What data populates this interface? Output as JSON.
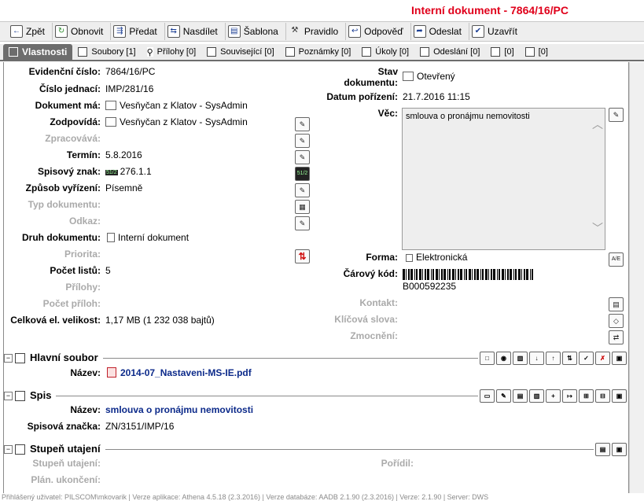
{
  "window": {
    "title": "Interní dokument - 7864/16/PC"
  },
  "toolbar": [
    {
      "label": "Zpět",
      "icon": "back-arrow-icon"
    },
    {
      "label": "Obnovit",
      "icon": "refresh-icon"
    },
    {
      "label": "Předat",
      "icon": "forward-icon"
    },
    {
      "label": "Nasdílet",
      "icon": "share-icon"
    },
    {
      "label": "Šablona",
      "icon": "template-icon"
    },
    {
      "label": "Pravidlo",
      "icon": "rule-icon"
    },
    {
      "label": "Odpověď",
      "icon": "reply-icon"
    },
    {
      "label": "Odeslat",
      "icon": "send-icon"
    },
    {
      "label": "Uzavřít",
      "icon": "close-document-icon"
    }
  ],
  "tabs": [
    {
      "label": "Vlastnosti",
      "active": true
    },
    {
      "label": "Soubory [1]"
    },
    {
      "label": "Přílohy [0]"
    },
    {
      "label": "Související [0]"
    },
    {
      "label": "Poznámky [0]"
    },
    {
      "label": "Úkoly [0]"
    },
    {
      "label": "Odeslání [0]"
    },
    {
      "label": "[0]"
    },
    {
      "label": "[0]"
    }
  ],
  "left": {
    "evidencni": {
      "label": "Evidenční číslo:",
      "value": "7864/16/PC"
    },
    "jednaci": {
      "label": "Číslo jednací:",
      "value": "IMP/281/16"
    },
    "dokument_ma": {
      "label": "Dokument má:",
      "value": "Vesňyčan z Klatov - SysAdmin"
    },
    "zodpovida": {
      "label": "Zodpovídá:",
      "value": "Vesňyčan z Klatov - SysAdmin"
    },
    "zpracovava": {
      "label": "Zpracovává:"
    },
    "termin": {
      "label": "Termín:",
      "value": "5.8.2016"
    },
    "spisovy_znak": {
      "label": "Spisový znak:",
      "value": "276.1.1",
      "badge": "51/2"
    },
    "zpusob": {
      "label": "Způsob vyřízení:",
      "value": "Písemně"
    },
    "typ": {
      "label": "Typ dokumentu:"
    },
    "odkaz": {
      "label": "Odkaz:"
    },
    "druh": {
      "label": "Druh dokumentu:",
      "value": "Interní dokument"
    },
    "priorita": {
      "label": "Priorita:"
    },
    "pocet_listu": {
      "label": "Počet listů:",
      "value": "5"
    },
    "prilohy": {
      "label": "Přílohy:"
    },
    "pocet_priloh": {
      "label": "Počet příloh:"
    },
    "velikost": {
      "label": "Celková el. velikost:",
      "value": "1,17 MB (1 232 038 bajtů)"
    }
  },
  "right": {
    "stav": {
      "label1": "Stav",
      "label2": "dokumentu:",
      "value": "Otevřený"
    },
    "datum": {
      "label": "Datum pořízení:",
      "value": "21.7.2016 11:15"
    },
    "vec": {
      "label": "Věc:",
      "value": "smlouva o pronájmu nemovitosti"
    },
    "forma": {
      "label": "Forma:",
      "value": "Elektronická"
    },
    "carovy": {
      "label": "Čárový kód:",
      "value": "B000592235"
    },
    "kontakt": {
      "label": "Kontakt:"
    },
    "klicova": {
      "label": "Klíčová slova:"
    },
    "zmocneni": {
      "label": "Zmocnění:"
    }
  },
  "hlavni_soubor": {
    "title": "Hlavní soubor",
    "name_label": "Název:",
    "name_value": "2014-07_Nastaveni-MS-IE.pdf"
  },
  "spis": {
    "title": "Spis",
    "name_label": "Název:",
    "name_value": "smlouva o pronájmu nemovitosti",
    "znacka_label": "Spisová značka:",
    "znacka_value": "ZN/3151/IMP/16"
  },
  "utajeni": {
    "title": "Stupeň utajení",
    "stupen_label": "Stupeň utajení:",
    "porizil_label": "Pořídil:",
    "plan_label": "Plán. ukončení:"
  },
  "footer": "Přihlášený uživatel: PILSCOM\\mkovarik  |  Verze aplikace: Athena 4.5.18 (2.3.2016)  |  Verze databáze: AADB 2.1.90 (2.3.2016)  |  Verze: 2.1.90  |  Server: DWS"
}
